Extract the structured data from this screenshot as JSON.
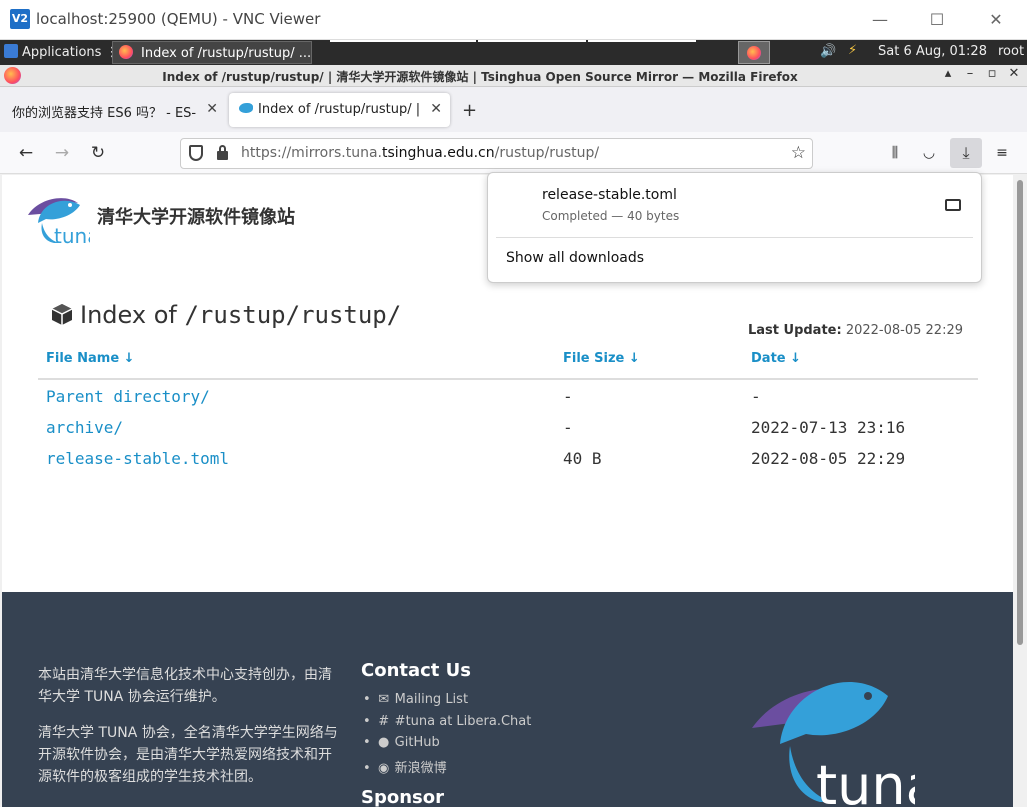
{
  "vnc": {
    "title": "localhost:25900 (QEMU) - VNC Viewer",
    "logo": "V2"
  },
  "panel": {
    "applications": "Applications",
    "task_label": "Index of /rustup/rustup/ ...",
    "clock": "Sat  6 Aug, 01:28",
    "user": "root"
  },
  "firefox": {
    "window_title": "Index of /rustup/rustup/ | 清华大学开源软件镜像站 | Tsinghua Open Source Mirror — Mozilla Firefox",
    "tabs": [
      {
        "label": "你的浏览器支持 ES6 吗？ - ES-",
        "active": false
      },
      {
        "label": "Index of /rustup/rustup/ |",
        "active": true
      }
    ],
    "url_prefix": "https://mirrors.tuna.",
    "url_domain": "tsinghua.edu.cn",
    "url_suffix": "/rustup/rustup/"
  },
  "downloads": {
    "file": "release-stable.toml",
    "status": "Completed — 40 bytes",
    "show_all": "Show all downloads"
  },
  "page": {
    "brand": "清华大学开源软件镜像站",
    "index_prefix": "Index of ",
    "index_path": "/rustup/rustup/",
    "last_update_label": "Last Update:",
    "last_update_value": "2022-08-05 22:29",
    "headers": {
      "name": "File Name  ↓",
      "size": "File Size  ↓",
      "date": "Date  ↓"
    },
    "rows": [
      {
        "name": "Parent directory/",
        "size": "-",
        "date": "-"
      },
      {
        "name": "archive/",
        "size": "-",
        "date": "2022-07-13 23:16"
      },
      {
        "name": "release-stable.toml",
        "size": "40 B",
        "date": "2022-08-05 22:29"
      }
    ]
  },
  "footer": {
    "para1": "本站由清华大学信息化技术中心支持创办，由清华大学 TUNA 协会运行维护。",
    "para2": "清华大学 TUNA 协会，全名清华大学学生网络与开源软件协会，是由清华大学热爱网络技术和开源软件的极客组成的学生技术社团。",
    "contact_title": "Contact Us",
    "contacts": [
      {
        "icon": "envelope-icon",
        "label": "Mailing List"
      },
      {
        "icon": "hash-icon",
        "label": "#tuna at Libera.Chat"
      },
      {
        "icon": "github-icon",
        "label": "GitHub"
      },
      {
        "icon": "weibo-icon",
        "label": "新浪微博"
      }
    ],
    "sponsor_title": "Sponsor"
  },
  "colors": {
    "link": "#1a8fc7",
    "footer_bg": "#364252",
    "tuna_blue": "#34a0d9",
    "tuna_purple": "#6b4ea0"
  }
}
